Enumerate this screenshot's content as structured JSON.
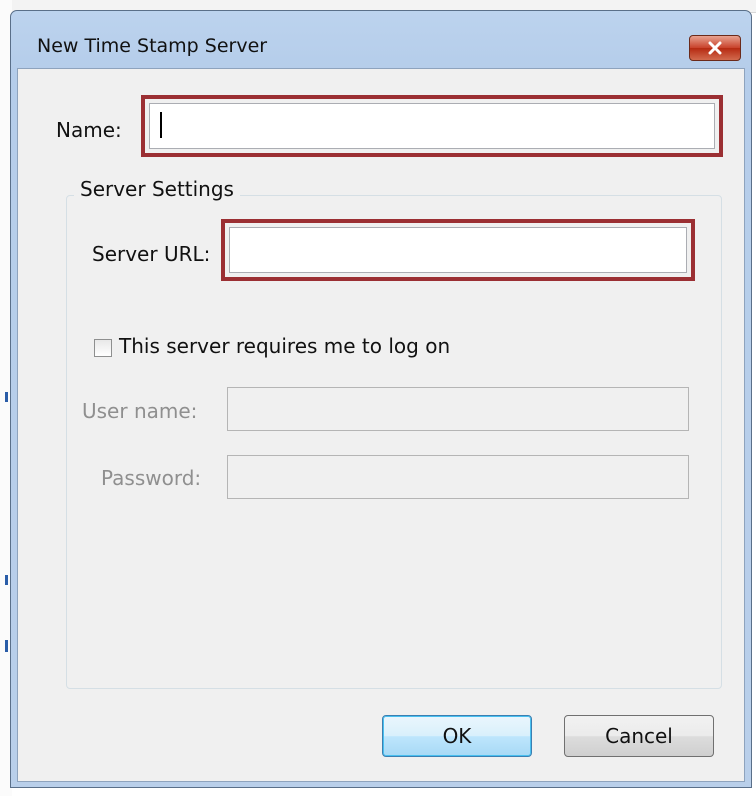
{
  "dialog": {
    "title": "New Time Stamp Server",
    "close_icon": "close-x-icon"
  },
  "form": {
    "name_label": "Name:",
    "name_value": "",
    "group_title": "Server Settings",
    "server_url_label": "Server URL:",
    "server_url_value": "",
    "login_checkbox_label": "This server requires me to log on",
    "login_checkbox_checked": false,
    "username_label": "User name:",
    "username_value": "",
    "password_label": "Password:",
    "password_value": ""
  },
  "buttons": {
    "ok_label": "OK",
    "cancel_label": "Cancel"
  },
  "colors": {
    "highlight": "#9b2f33",
    "titlebar": "#b9cfea",
    "close_button": "#c8412a"
  }
}
